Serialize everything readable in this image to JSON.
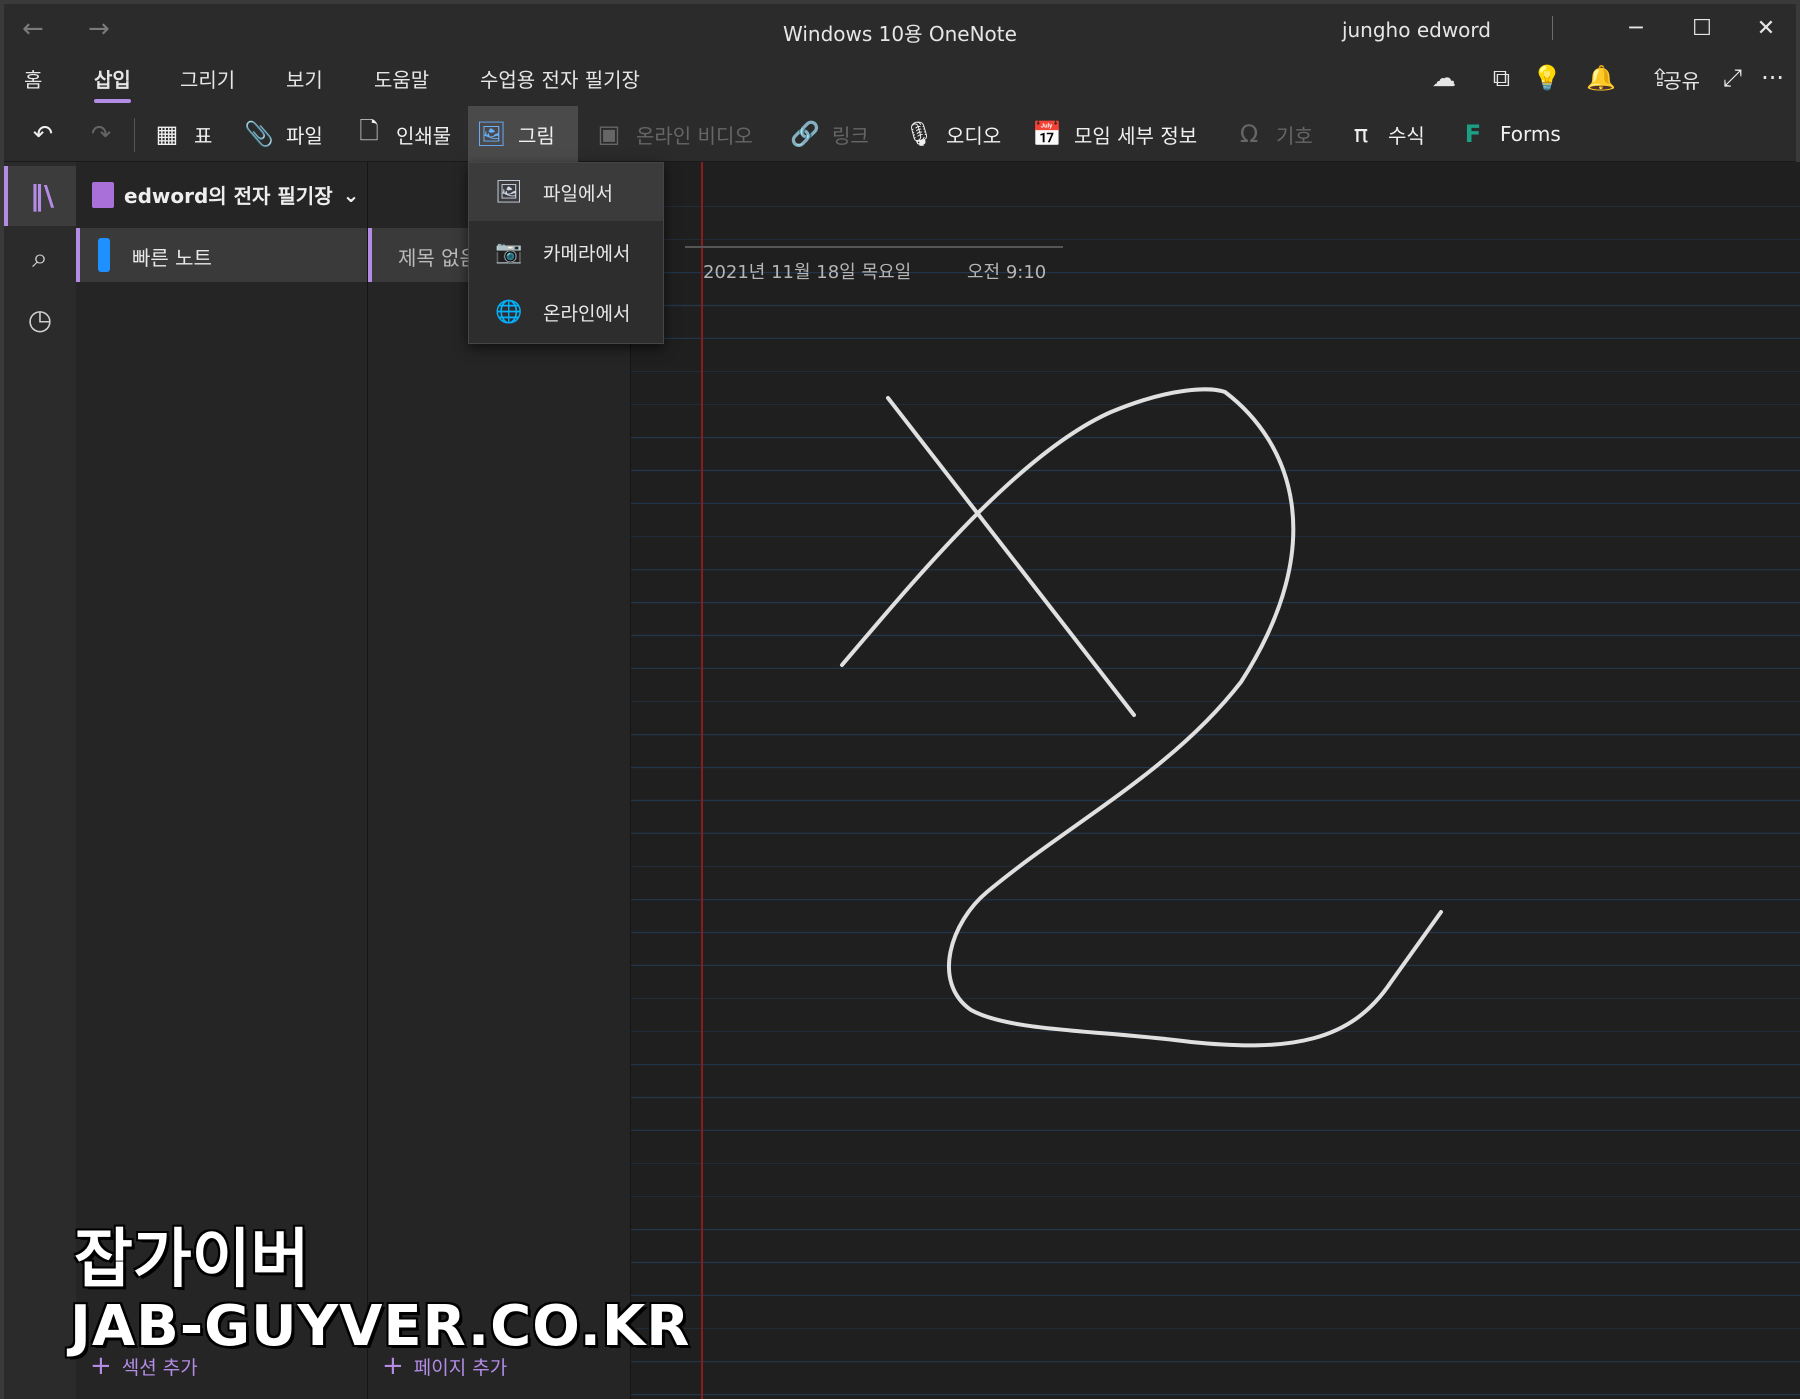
{
  "titlebar": {
    "title": "Windows 10용 OneNote",
    "user": "jungho edword",
    "back": "←",
    "forward": "→",
    "minimize": "─",
    "maximize": "☐",
    "close": "✕"
  },
  "tabs": [
    {
      "label": "홈"
    },
    {
      "label": "삽입",
      "active": true
    },
    {
      "label": "그리기"
    },
    {
      "label": "보기"
    },
    {
      "label": "도움말"
    },
    {
      "label": "수업용 전자 필기장"
    }
  ],
  "tab_actions": {
    "sync_icon": "☁",
    "pages_icon": "⧉",
    "tips_icon": "💡",
    "notify_icon": "🔔",
    "share_label": "공유",
    "expand_icon": "⤢",
    "more_icon": "···"
  },
  "toolbar": {
    "undo_icon": "↶",
    "redo_icon": "↷",
    "table": "표",
    "file": "파일",
    "printout": "인쇄물",
    "picture": "그림",
    "online_video": "온라인 비디오",
    "link": "링크",
    "audio": "오디오",
    "meeting": "모임 세부 정보",
    "symbol": "기호",
    "equation": "수식",
    "forms": "Forms"
  },
  "picture_menu": [
    {
      "label": "파일에서",
      "icon": "image-icon"
    },
    {
      "label": "카메라에서",
      "icon": "camera-icon"
    },
    {
      "label": "온라인에서",
      "icon": "online-image-icon"
    }
  ],
  "notebook": {
    "name": "edword의 전자 필기장",
    "section": "빠른 노트",
    "page": "제목 없음",
    "add_section": "섹션 추가",
    "add_page": "페이지 추가"
  },
  "page": {
    "date": "2021년 11월 18일 목요일",
    "time": "오전 9:10"
  },
  "colors": {
    "accent": "#b48ce6",
    "section_tab": "#1e90ff",
    "margin": "#8a1c1c",
    "rule": "#22364d"
  },
  "watermark": {
    "line1": "잡가이버",
    "line2": "JAB-GUYVER.CO.KR"
  }
}
